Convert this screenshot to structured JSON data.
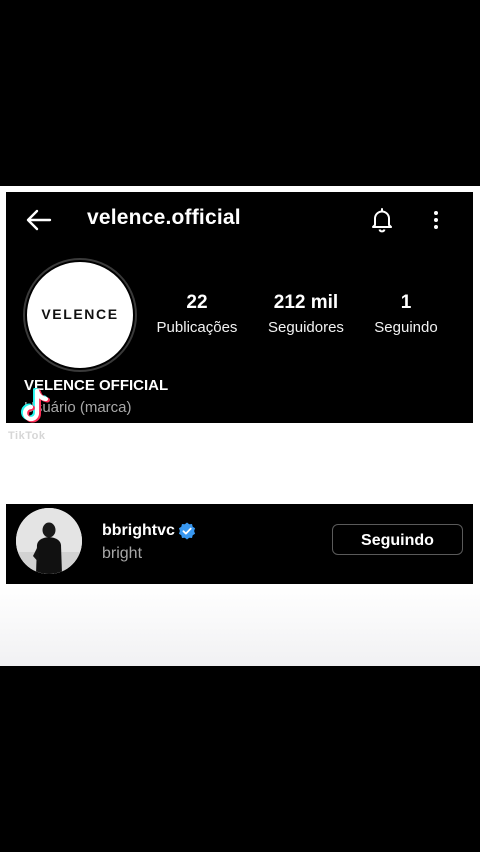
{
  "header": {
    "username": "velence.official"
  },
  "profile": {
    "avatar_text": "VELENCE",
    "stats": [
      {
        "value": "22",
        "label": "Publicações"
      },
      {
        "value": "212 mil",
        "label": "Seguidores"
      },
      {
        "value": "1",
        "label": "Seguindo"
      }
    ],
    "display_name": "VELENCE OFFICIAL",
    "category": "Usuário (marca)"
  },
  "watermark": {
    "text": "TikTok"
  },
  "following_account": {
    "username": "bbrightvc",
    "name": "bright",
    "button_label": "Seguindo",
    "verified": true
  },
  "colors": {
    "verified": "#3897f0",
    "secondary_text": "#a8a8a8"
  }
}
